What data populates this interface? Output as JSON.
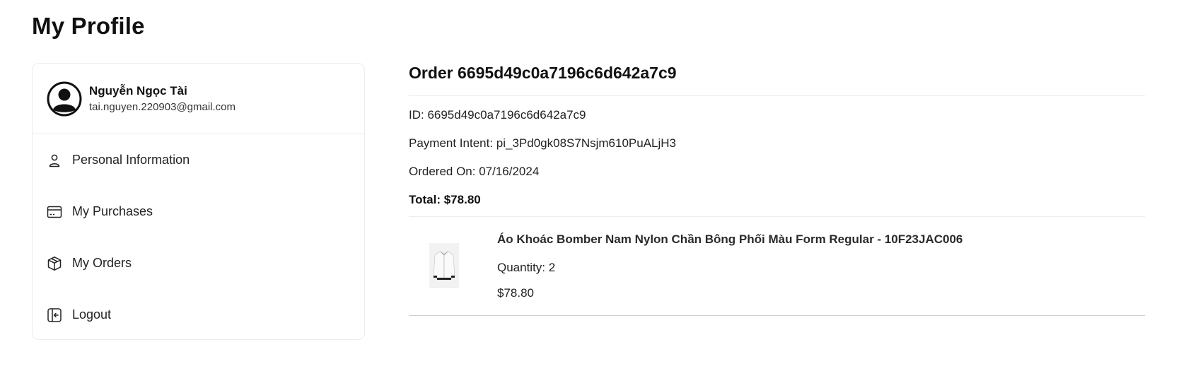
{
  "page": {
    "title": "My Profile"
  },
  "sidebar": {
    "user": {
      "name": "Nguyễn Ngọc Tài",
      "email": "tai.nguyen.220903@gmail.com",
      "avatar_icon": "user-avatar-icon"
    },
    "items": [
      {
        "label": "Personal Information",
        "icon": "user-icon"
      },
      {
        "label": "My Purchases",
        "icon": "card-icon"
      },
      {
        "label": "My Orders",
        "icon": "package-icon"
      },
      {
        "label": "Logout",
        "icon": "logout-icon"
      }
    ]
  },
  "order": {
    "title": "Order 6695d49c0a7196c6d642a7c9",
    "id_line": "ID: 6695d49c0a7196c6d642a7c9",
    "payment_line": "Payment Intent: pi_3Pd0gk08S7Nsjm610PuALjH3",
    "date_line": "Ordered On: 07/16/2024",
    "total_line": "Total: $78.80",
    "items": [
      {
        "name": "Áo Khoác Bomber Nam Nylon Chần Bông Phối Màu Form Regular - 10F23JAC006",
        "quantity_line": "Quantity: 2",
        "price": "$78.80",
        "image_icon": "jacket-thumbnail"
      }
    ]
  }
}
